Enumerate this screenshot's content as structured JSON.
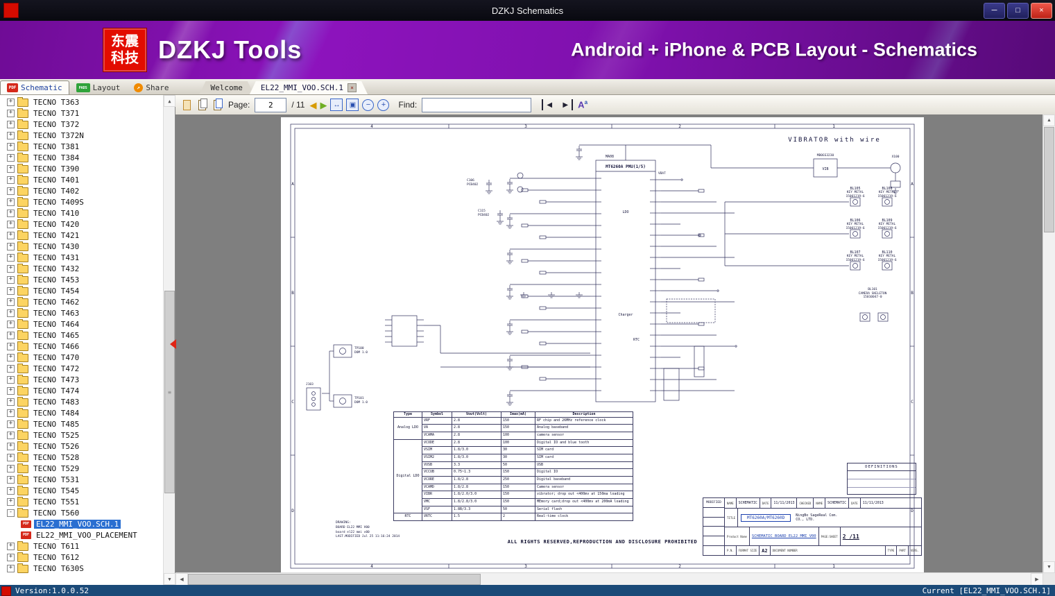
{
  "window": {
    "title": "DZKJ Schematics",
    "minimize": "─",
    "maximize": "□",
    "close": "×"
  },
  "banner": {
    "logo_line1": "东震",
    "logo_line2": "科技",
    "app_name": "DZKJ Tools",
    "tagline": "Android + iPhone & PCB Layout - Schematics"
  },
  "ribbon_tabs": [
    {
      "label": "Schematic",
      "icon": "pdf",
      "icon_text": "PDF",
      "active": true
    },
    {
      "label": "Layout",
      "icon": "pads",
      "icon_text": "PADS",
      "active": false
    },
    {
      "label": "Share",
      "icon": "share",
      "icon_text": "",
      "active": false
    }
  ],
  "doc_tabs": [
    {
      "label": "Welcome",
      "active": false,
      "closable": false
    },
    {
      "label": "EL22_MMI_VOO.SCH.1",
      "active": true,
      "closable": true
    }
  ],
  "icons": {
    "expand": "+",
    "collapse": "-",
    "up": "▲",
    "down": "▼",
    "left": "◀",
    "right": "▶",
    "grip": "≡",
    "close_tab": "×"
  },
  "toolbar": {
    "page_label": "Page:",
    "page_value": "2",
    "page_total": "/ 11",
    "find_label": "Find:",
    "find_value": "",
    "icons": {
      "prev": "◀",
      "next": "▶",
      "fit_width": "↔",
      "fit_page": "▣",
      "zoom_out": "−",
      "zoom_in": "+",
      "find_prev": "◀",
      "find_next": "▶",
      "font_big": "A",
      "font_small": "a"
    }
  },
  "sidebar": {
    "items": [
      {
        "label": "TECNO T363"
      },
      {
        "label": "TECNO T371"
      },
      {
        "label": "TECNO T372"
      },
      {
        "label": "TECNO T372N"
      },
      {
        "label": "TECNO T381"
      },
      {
        "label": "TECNO T384"
      },
      {
        "label": "TECNO T390"
      },
      {
        "label": "TECNO T401"
      },
      {
        "label": "TECNO T402"
      },
      {
        "label": "TECNO T409S"
      },
      {
        "label": "TECNO T410"
      },
      {
        "label": "TECNO T420"
      },
      {
        "label": "TECNO T421"
      },
      {
        "label": "TECNO T430"
      },
      {
        "label": "TECNO T431"
      },
      {
        "label": "TECNO T432"
      },
      {
        "label": "TECNO T453"
      },
      {
        "label": "TECNO T454"
      },
      {
        "label": "TECNO T462"
      },
      {
        "label": "TECNO T463"
      },
      {
        "label": "TECNO T464"
      },
      {
        "label": "TECNO T465"
      },
      {
        "label": "TECNO T466"
      },
      {
        "label": "TECNO T470"
      },
      {
        "label": "TECNO T472"
      },
      {
        "label": "TECNO T473"
      },
      {
        "label": "TECNO T474"
      },
      {
        "label": "TECNO T483"
      },
      {
        "label": "TECNO T484"
      },
      {
        "label": "TECNO T485"
      },
      {
        "label": "TECNO T525"
      },
      {
        "label": "TECNO T526"
      },
      {
        "label": "TECNO T528"
      },
      {
        "label": "TECNO T529"
      },
      {
        "label": "TECNO T531"
      },
      {
        "label": "TECNO T545"
      },
      {
        "label": "TECNO T551"
      },
      {
        "label": "TECNO T560",
        "expanded": true,
        "children": [
          {
            "label": "EL22_MMI_VOO.SCH.1",
            "type": "pdf",
            "selected": true
          },
          {
            "label": "EL22_MMI_VOO_PLACEMENT",
            "type": "pdf"
          }
        ]
      },
      {
        "label": "TECNO T611"
      },
      {
        "label": "TECNO T612"
      },
      {
        "label": "TECNO T630S"
      }
    ]
  },
  "statusbar": {
    "left": "Version:1.0.0.52",
    "right": "Current [EL22_MMI_VOO.SCH.1]"
  },
  "schematic": {
    "grid_cols": [
      "4",
      "3",
      "2",
      "1"
    ],
    "grid_rows": [
      "A",
      "B",
      "C",
      "D"
    ],
    "vibrator_title": "VIBRATOR with wire",
    "chip_ref": "MA08",
    "chip_title": "MT6260A PMU(1/5)",
    "chip_sections": {
      "ldo": "LDO",
      "charger": "Charger",
      "rtc": "RTC"
    },
    "net_vbat": "VBAT",
    "vib_label": "VIB",
    "vib_part": "MB0GS3230",
    "x100_ref": "X100",
    "c106": "C106",
    "c106_pkg": "PCB402",
    "c115": "C115",
    "c115_pkg": "PCB402",
    "tp100": "TP100",
    "tp101": "TP101",
    "tp_sub": "DOM 1.0",
    "j103": "J103",
    "key_metal": {
      "refs": [
        "BL105",
        "BL108",
        "BL106",
        "BL109",
        "BL107",
        "BL110"
      ],
      "name": "KEY METAL",
      "part": "15061219-6"
    },
    "camera_skeleton": {
      "ref": "BL101",
      "name": "CAMERA SKELETON",
      "part": "15010047-0"
    },
    "ldo_table": {
      "headers": [
        "Type",
        "Symbol",
        "Vout(Volt)",
        "Imax(mA)",
        "Description"
      ],
      "rows": [
        [
          "Analog LDO",
          "VRF",
          "2.8",
          "150",
          "RF chip and 26MHz reference clock"
        ],
        [
          "",
          "VA",
          "2.8",
          "150",
          "Analog baseband"
        ],
        [
          "",
          "VCAMA",
          "2.8",
          "100",
          "camera sensor"
        ],
        [
          "Digital LDO",
          "VCODE",
          "2.8",
          "100",
          "Digital IO and blue tooth"
        ],
        [
          "",
          "VSIM",
          "1.8/3.0",
          "30",
          "SIM card"
        ],
        [
          "",
          "VSIM2",
          "1.8/3.0",
          "30",
          "SIM card"
        ],
        [
          "",
          "VUSB",
          "3.3",
          "50",
          "USB"
        ],
        [
          "",
          "VCCUB",
          "0.75~1.3",
          "150",
          "Digital IO"
        ],
        [
          "",
          "VCORE",
          "1.8/2.8",
          "250",
          "Digital baseband"
        ],
        [
          "",
          "VCAMD",
          "1.8/2.8",
          "150",
          "Camera sensor"
        ],
        [
          "",
          "VIBR",
          "1.8/2.0/3.0",
          "150",
          "vibrator; drop out <400mv at 150ma loading"
        ],
        [
          "",
          "VMC",
          "1.8/2.8/3.0",
          "150",
          "MEmory card;drop out <400mv at 200mA loading"
        ],
        [
          "",
          "VSF",
          "1.8B/3.3",
          "50",
          "Serial flash"
        ],
        [
          "RTC",
          "VRTC",
          "1.5",
          "2",
          "Real-time clock"
        ]
      ]
    },
    "drawing_label": "DRAWING:",
    "drawing_line1": "BOARD EL22 MMI V00",
    "drawing_line2": "board el22 mmi v00",
    "drawing_modified": "LAST.MODIFIED Jul 25 11:16:24 2014",
    "footer": "ALL RIGHTS RESERVED,REPRODUCTION AND DISCLOSURE PROHIBITED",
    "definitions_title": "DEFINITIONS",
    "titleblock": {
      "modified": "MODIFIED",
      "name_label": "NAME",
      "name_value": "SCHEMATIC",
      "date_label": "DATE",
      "date_value": "11/11/2013",
      "checked_label": "CHECKED",
      "name2_value": "SCHEMATIC",
      "date2_value": "11/11/2013",
      "title_label": "TITLE",
      "title_value": "MT6260A/MT6260D",
      "company_line1": "NingBo SageReal Com.",
      "company_line2": "CO., LTD.",
      "product_label": "Product Name",
      "product_value": "SCHEMATIC BOARD EL22 MMI V00",
      "page_label": "PAGE:SHEET",
      "page_value": "2 /11",
      "pn_label": "P.N.",
      "format_label": "FORMAT SIZE",
      "format_value": "A2",
      "docnum_label": "DOCUMENT NUMBER",
      "type_label": "TYPE",
      "part_label": "PART",
      "vers_label": "VERS."
    }
  }
}
